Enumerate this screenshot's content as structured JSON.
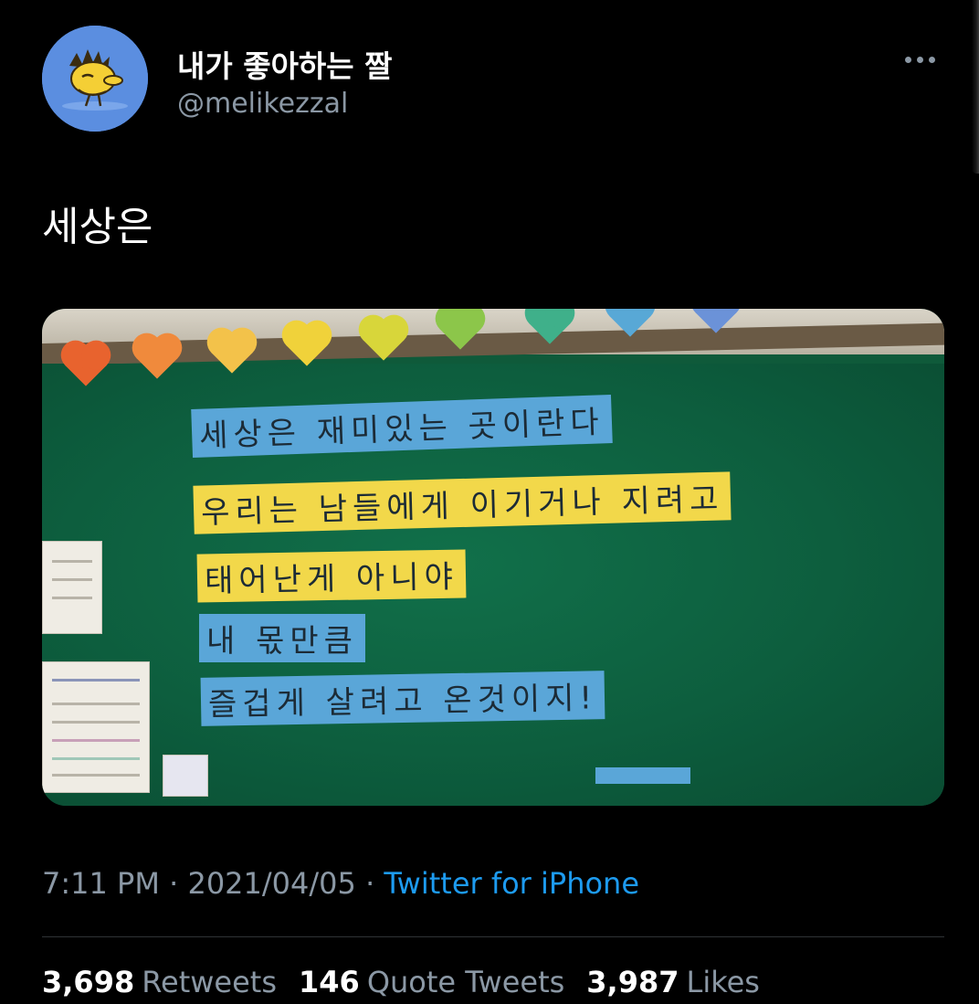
{
  "author": {
    "display_name": "내가 좋아하는 짤",
    "handle": "@melikezzal",
    "avatar_icon": "woodstock-avatar"
  },
  "more_icon": "more-horizontal-icon",
  "tweet": {
    "text": "세상은"
  },
  "media": {
    "board_lines": [
      "세상은 재미있는 곳이란다",
      "우리는 남들에게 이기거나 지려고",
      "태어난게 아니야",
      "내 몫만큼",
      "즐겁게 살려고 온것이지!"
    ]
  },
  "meta": {
    "time": "7:11 PM",
    "separator": " · ",
    "date": "2021/04/05",
    "source": "Twitter for iPhone"
  },
  "stats": {
    "retweets_count": "3,698",
    "retweets_label": "Retweets",
    "quotes_count": "146",
    "quotes_label": "Quote Tweets",
    "likes_count": "3,987",
    "likes_label": "Likes"
  },
  "colors": {
    "background": "#000000",
    "muted_text": "#8b98a5",
    "link": "#1d9bf0",
    "avatar_bg": "#5b8ee0",
    "board_green": "#0f5a3a",
    "strip_blue": "#5aa6d8",
    "strip_yellow": "#f2d84a"
  }
}
